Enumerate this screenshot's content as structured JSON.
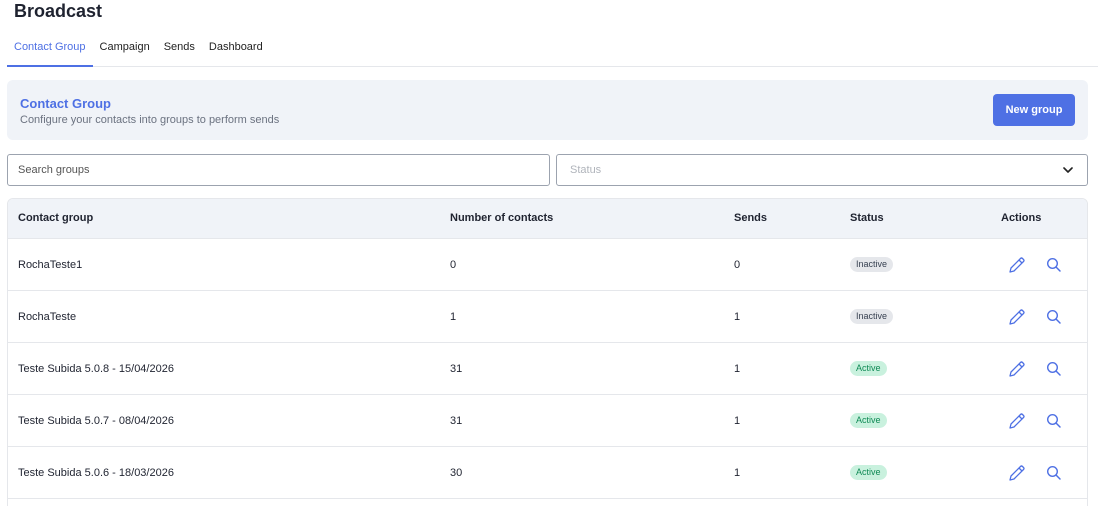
{
  "page": {
    "title": "Broadcast"
  },
  "tabs": [
    {
      "label": "Contact Group",
      "active": true
    },
    {
      "label": "Campaign",
      "active": false
    },
    {
      "label": "Sends",
      "active": false
    },
    {
      "label": "Dashboard",
      "active": false
    }
  ],
  "header": {
    "title": "Contact Group",
    "subtitle": "Configure your contacts into groups to perform sends",
    "new_button_label": "New group"
  },
  "filters": {
    "search_placeholder": "Search groups",
    "status_placeholder": "Status"
  },
  "table": {
    "headers": [
      "Contact group",
      "Number of contacts",
      "Sends",
      "Status",
      "Actions"
    ],
    "rows": [
      {
        "name": "RochaTeste1",
        "contacts": "0",
        "sends": "0",
        "status": "Inactive"
      },
      {
        "name": "RochaTeste",
        "contacts": "1",
        "sends": "1",
        "status": "Inactive"
      },
      {
        "name": "Teste Subida 5.0.8 - 15/04/2026",
        "contacts": "31",
        "sends": "1",
        "status": "Active"
      },
      {
        "name": "Teste Subida 5.0.7 - 08/04/2026",
        "contacts": "31",
        "sends": "1",
        "status": "Active"
      },
      {
        "name": "Teste Subida 5.0.6 - 18/03/2026",
        "contacts": "30",
        "sends": "1",
        "status": "Active"
      }
    ]
  },
  "colors": {
    "accent": "#4e70e4",
    "active_badge_bg": "#c9f1de",
    "active_badge_text": "#0f8a55",
    "inactive_badge_bg": "#e5e7eb"
  },
  "icons": {
    "edit": "pencil-icon",
    "view": "search-icon",
    "dropdown": "chevron-down-icon"
  }
}
